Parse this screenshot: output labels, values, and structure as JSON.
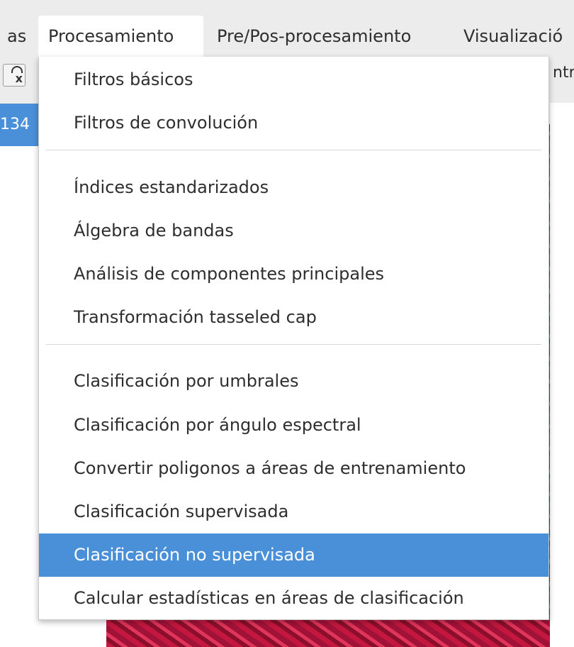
{
  "menubar": {
    "items": [
      {
        "label": "as"
      },
      {
        "label": "Procesamiento"
      },
      {
        "label": "Pre/Pos-procesamiento"
      },
      {
        "label": "Visualizació"
      }
    ]
  },
  "toolbar": {
    "right_text": "ntr",
    "tree_selected_text": "134"
  },
  "dropdown": {
    "items": [
      {
        "label": "Filtros básicos"
      },
      {
        "label": "Filtros de convolución"
      },
      {
        "label": "Índices estandarizados"
      },
      {
        "label": "Álgebra de bandas"
      },
      {
        "label": "Análisis de componentes principales"
      },
      {
        "label": "Transformación tasseled cap"
      },
      {
        "label": "Clasificación por umbrales"
      },
      {
        "label": "Clasificación por ángulo espectral"
      },
      {
        "label": "Convertir poligonos a áreas de entrenamiento"
      },
      {
        "label": "Clasificación supervisada"
      },
      {
        "label": "Clasificación no supervisada"
      },
      {
        "label": "Calcular estadísticas en áreas de clasificación"
      }
    ],
    "highlighted_index": 10
  },
  "colors": {
    "highlight": "#4a90d9",
    "menubar_bg": "#ececec",
    "menu_bg": "#ffffff"
  },
  "icons": {
    "toolbar_icon": "function-fx-icon"
  }
}
